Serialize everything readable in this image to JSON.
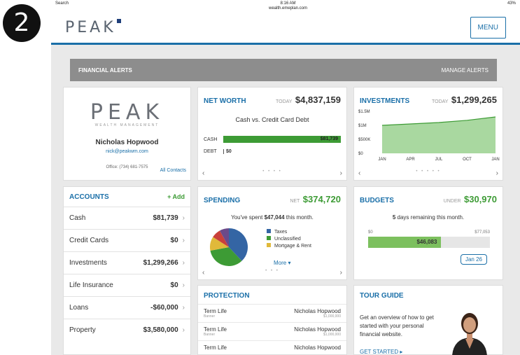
{
  "step": "2",
  "status": {
    "left": "Search",
    "time": "8:16 AM",
    "url": "wealth.emeplan.com",
    "right": "43%"
  },
  "header": {
    "logo": "PEAK",
    "menu_label": "MENU"
  },
  "alerts": {
    "title": "FINANCIAL ALERTS",
    "manage": "MANAGE ALERTS"
  },
  "profile": {
    "logo": "PEAK",
    "logo_sub": "WEALTH MANAGEMENT",
    "name": "Nicholas Hopwood",
    "email": "nick@peakwm.com",
    "office": "Office: (734) 681-7575",
    "all_contacts": "All Contacts"
  },
  "accounts": {
    "title": "ACCOUNTS",
    "add": "+ Add",
    "rows": [
      {
        "label": "Cash",
        "value": "$81,739"
      },
      {
        "label": "Credit Cards",
        "value": "$0"
      },
      {
        "label": "Investments",
        "value": "$1,299,266"
      },
      {
        "label": "Life Insurance",
        "value": "$0"
      },
      {
        "label": "Loans",
        "value": "-$60,000"
      },
      {
        "label": "Property",
        "value": "$3,580,000"
      }
    ]
  },
  "networth": {
    "title": "NET WORTH",
    "today": "TODAY",
    "value": "$4,837,159",
    "subtitle": "Cash vs. Credit Card Debt",
    "cash_label": "CASH",
    "cash_value": "$81,739",
    "debt_label": "DEBT",
    "debt_value": "$0"
  },
  "investments": {
    "title": "INVESTMENTS",
    "today": "TODAY",
    "value": "$1,299,265"
  },
  "spending": {
    "title": "SPENDING",
    "net": "NET",
    "value": "$374,720",
    "text_pre": "You've spent",
    "amount": "$47,044",
    "text_post": "this month.",
    "legend": [
      "Taxes",
      "Unclassified",
      "Mortgage & Rent"
    ],
    "more": "More ▾"
  },
  "budgets": {
    "title": "BUDGETS",
    "under": "UNDER",
    "value": "$30,970",
    "days": "5",
    "days_text": "days remaining this month.",
    "min": "$0",
    "max": "$77,053",
    "spent": "$46,083",
    "date": "Jan 26",
    "progress": 0.6
  },
  "protection": {
    "title": "PROTECTION",
    "rows": [
      {
        "type": "Term Life",
        "sub": "Banner",
        "name": "Nicholas Hopwood",
        "amount": "$1,000,000"
      },
      {
        "type": "Term Life",
        "sub": "Banner",
        "name": "Nicholas Hopwood",
        "amount": "$1,000,000"
      },
      {
        "type": "Term Life",
        "sub": "",
        "name": "Nicholas Hopwood",
        "amount": ""
      }
    ]
  },
  "tour": {
    "title": "TOUR GUIDE",
    "text": "Get an overview of how to get started with your personal financial website.",
    "cta": "GET STARTED ▸"
  },
  "colors": {
    "accent": "#1a6fa8",
    "green": "#3d9b35"
  },
  "chart_data": [
    {
      "type": "bar",
      "title": "Cash vs. Credit Card Debt",
      "categories": [
        "CASH",
        "DEBT"
      ],
      "values": [
        81739,
        0
      ]
    },
    {
      "type": "area",
      "categories": [
        "JAN",
        "APR",
        "JUL",
        "OCT",
        "JAN"
      ],
      "values": [
        1000000,
        1050000,
        1100000,
        1180000,
        1299265
      ],
      "y_ticks": [
        "$0",
        "$500K",
        "$1M",
        "$1.5M"
      ],
      "ylim": [
        0,
        1500000
      ]
    },
    {
      "type": "pie",
      "series": [
        {
          "name": "Taxes",
          "value": 0.38,
          "color": "#3465a4"
        },
        {
          "name": "Unclassified",
          "value": 0.34,
          "color": "#3d9b35"
        },
        {
          "name": "Mortgage & Rent",
          "value": 0.12,
          "color": "#e0b93a"
        },
        {
          "name": "",
          "value": 0.08,
          "color": "#c9403a"
        },
        {
          "name": "",
          "value": 0.08,
          "color": "#6b4a8a"
        }
      ]
    }
  ]
}
